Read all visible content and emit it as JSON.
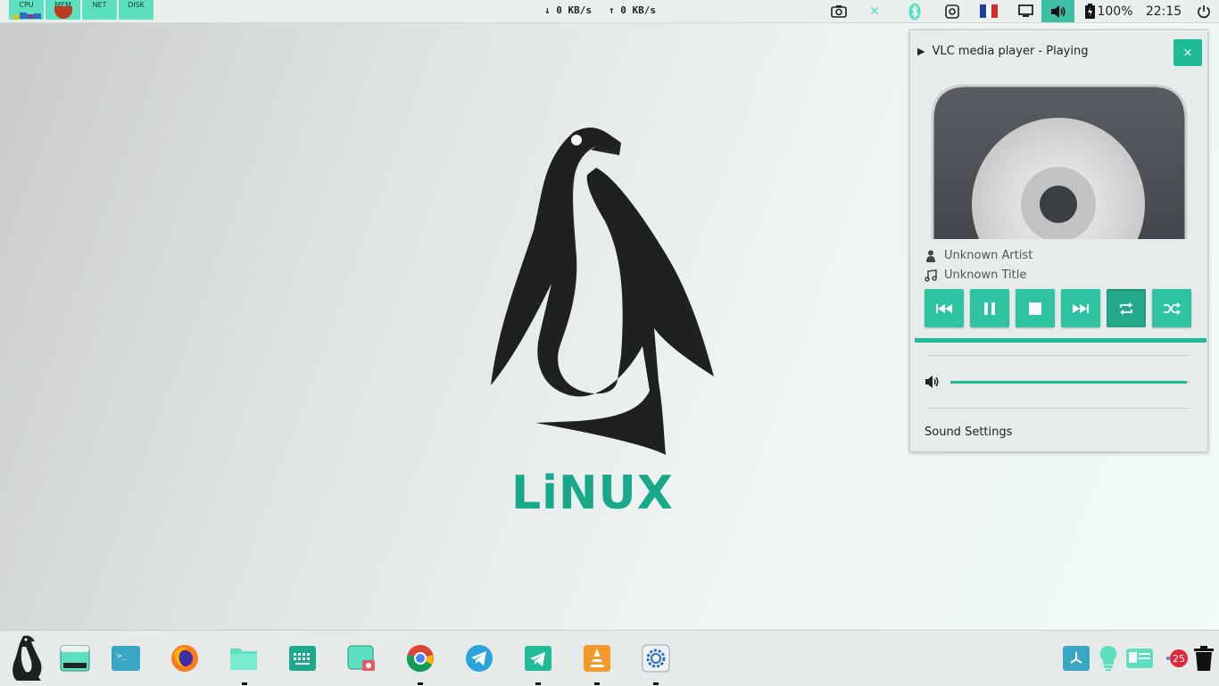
{
  "top_panel": {
    "monitors": [
      {
        "label": "CPU"
      },
      {
        "label": "MEM"
      },
      {
        "label": "NET"
      },
      {
        "label": "DISK"
      }
    ],
    "download": "↓ 0 KB/s",
    "upload": "↑ 0 KB/s",
    "tray": {
      "screenshot_icon": "camera-icon",
      "clipboard_icon": "close-x-icon",
      "bluetooth_icon": "bluetooth-icon",
      "recorder_icon": "record-icon",
      "keyboard_layout_icon": "french-flag-icon",
      "display_icon": "screen-icon",
      "volume_icon": "speaker-icon",
      "battery_text": "100%",
      "clock": "22:15",
      "power_icon": "power-icon"
    },
    "accent": "#5ce0c0",
    "active_tray_color": "#3cbfa4"
  },
  "desktop": {
    "logo_text": "LiNUX",
    "logo_color": "#18a88a"
  },
  "media_popup": {
    "title": "VLC media player - Playing",
    "close_label": "×",
    "artist": "Unknown Artist",
    "track_title": "Unknown Title",
    "controls": [
      {
        "name": "previous-icon",
        "active": false
      },
      {
        "name": "pause-icon",
        "active": false
      },
      {
        "name": "stop-icon",
        "active": false
      },
      {
        "name": "next-icon",
        "active": false
      },
      {
        "name": "repeat-icon",
        "active": true
      },
      {
        "name": "shuffle-icon",
        "active": false
      }
    ],
    "progress_fraction": 1.0,
    "volume_fraction": 0.99,
    "sound_settings_label": "Sound Settings",
    "accent": "#1ebc96"
  },
  "dock": {
    "items": [
      {
        "name": "linux-menu-icon"
      },
      {
        "name": "terminal-window-icon"
      },
      {
        "name": "terminal-icon"
      },
      {
        "name": "firefox-icon"
      },
      {
        "name": "files-icon"
      },
      {
        "name": "keyboard-icon"
      },
      {
        "name": "screenshot-app-icon"
      },
      {
        "name": "chrome-icon"
      },
      {
        "name": "telegram-icon"
      },
      {
        "name": "telegram-desktop-icon"
      },
      {
        "name": "vlc-icon"
      },
      {
        "name": "settings-icon"
      }
    ],
    "tray_items": [
      {
        "name": "clock-app-icon"
      },
      {
        "name": "bulb-icon"
      },
      {
        "name": "id-card-icon"
      },
      {
        "name": "notification-badge",
        "badge": "25"
      },
      {
        "name": "trash-icon"
      }
    ]
  }
}
